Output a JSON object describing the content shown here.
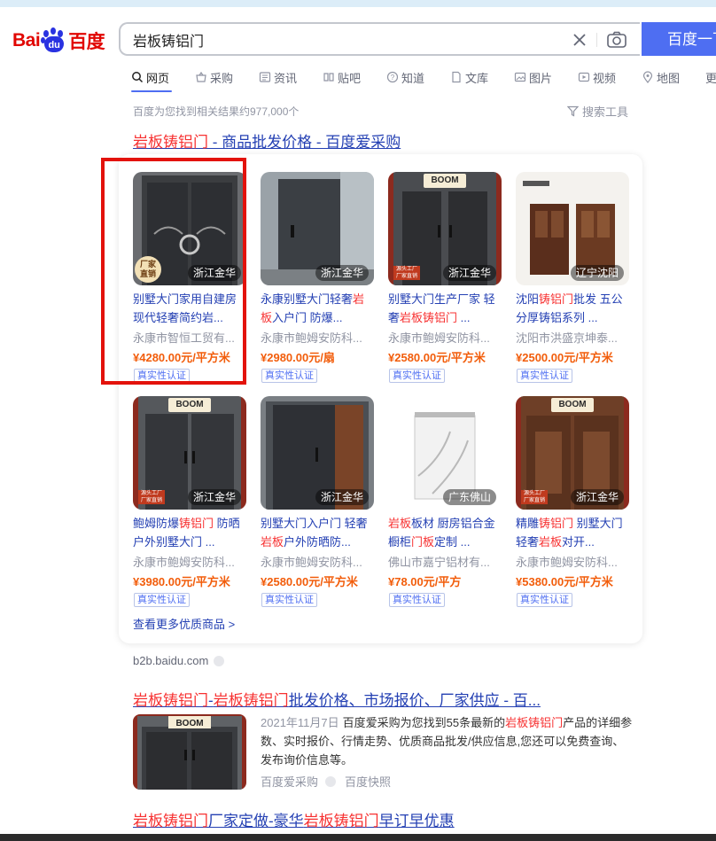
{
  "logo": {
    "text_left": "Bai",
    "text_paw": "du",
    "text_right": "百度"
  },
  "search": {
    "query": "岩板铸铝门",
    "button": "百度一下"
  },
  "tabs": [
    {
      "label": "网页",
      "icon": "search-icon"
    },
    {
      "label": "采购",
      "icon": "basket-icon"
    },
    {
      "label": "资讯",
      "icon": "news-icon"
    },
    {
      "label": "贴吧",
      "icon": "tieba-icon"
    },
    {
      "label": "知道",
      "icon": "question-icon"
    },
    {
      "label": "文库",
      "icon": "document-icon"
    },
    {
      "label": "图片",
      "icon": "image-icon"
    },
    {
      "label": "视频",
      "icon": "play-icon"
    },
    {
      "label": "地图",
      "icon": "map-pin-icon"
    },
    {
      "label": "更多",
      "icon": ""
    }
  ],
  "result_count": "百度为您找到相关结果约977,000个",
  "search_tools": "搜索工具",
  "result1": {
    "title_em": "岩板铸铝门",
    "title_rest": " - 商品批发价格 - 百度爱采购",
    "more_link": "查看更多优质商品 >",
    "source_url": "b2b.baidu.com",
    "products": [
      {
        "name_parts": [
          "别墅大门家用自建房现代轻奢简约岩..."
        ],
        "shop": "永康市智恒工贸有...",
        "price": "¥4280.00元/平方米",
        "location": "浙江金华",
        "badge": "厂家\n直销",
        "verify": "真实性认证",
        "style": "a"
      },
      {
        "name_parts": [
          "永康别墅大门轻奢",
          "岩板",
          "入户门 防爆..."
        ],
        "shop": "永康市鲍姆安防科...",
        "price": "¥2980.00元/扇",
        "location": "浙江金华",
        "badge": "",
        "verify": "真实性认证",
        "style": "b"
      },
      {
        "name_parts": [
          "别墅大门生产厂家 轻奢",
          "岩板铸铝门",
          " ..."
        ],
        "shop": "永康市鲍姆安防科...",
        "price": "¥2580.00元/平方米",
        "location": "浙江金华",
        "badge": "源头工厂 厂家直销",
        "boom": "BOOM",
        "verify": "真实性认证",
        "style": "c"
      },
      {
        "name_parts": [
          "沈阳",
          "铸铝门",
          "批发 五公分厚铸铝系列 ..."
        ],
        "shop": "沈阳市洪盛京坤泰...",
        "price": "¥2500.00元/平方米",
        "location": "辽宁沈阳",
        "badge": "",
        "verify": "真实性认证",
        "style": "d"
      },
      {
        "name_parts": [
          "鲍姆防爆",
          "铸铝门",
          " 防晒户外别墅大门 ..."
        ],
        "shop": "永康市鲍姆安防科...",
        "price": "¥3980.00元/平方米",
        "location": "浙江金华",
        "badge": "源头工厂 厂家直销",
        "boom": "BOOM",
        "verify": "真实性认证",
        "style": "e"
      },
      {
        "name_parts": [
          "别墅大门入户门 轻奢",
          "岩板",
          "户外防晒防..."
        ],
        "shop": "永康市鲍姆安防科...",
        "price": "¥2580.00元/平方米",
        "location": "浙江金华",
        "badge": "",
        "verify": "真实性认证",
        "style": "f"
      },
      {
        "name_parts": [
          "岩板",
          "板材 厨房铝合金橱柜",
          "门板",
          "定制 ..."
        ],
        "shop": "佛山市嘉宁铝材有...",
        "price": "¥78.00元/平方",
        "location": "广东佛山",
        "badge": "",
        "verify": "真实性认证",
        "style": "g"
      },
      {
        "name_parts": [
          "精雕",
          "铸铝门",
          " 别墅大门轻奢",
          "岩板",
          "对开..."
        ],
        "shop": "永康市鲍姆安防科...",
        "price": "¥5380.00元/平方米",
        "location": "浙江金华",
        "badge": "源头工厂 厂家直销",
        "boom": "BOOM",
        "verify": "真实性认证",
        "style": "h"
      }
    ]
  },
  "result2": {
    "title_parts": [
      "岩板铸铝门",
      "-",
      "岩板铸铝门",
      "批发价格、市场报价、厂家供应 - 百..."
    ],
    "date": "2021年11月7日",
    "abstract_parts": [
      "百度爱采购为您找到55条最新的",
      "岩板铸铝门",
      "产品的详细参数、实时报价、行情走势、优质商品批发/供应信息,您还可以免费查询、发布询价信息等。"
    ],
    "source": "百度爱采购",
    "snapshot": "百度快照",
    "boom": "BOOM"
  },
  "result3": {
    "title_parts": [
      "岩板铸铝门",
      "厂家定做-豪华",
      "岩板铸铝门",
      "早订早优惠"
    ]
  },
  "colors": {
    "accent": "#4e6ef2",
    "highlight": "#f73131",
    "link": "#2440b3",
    "price": "#f25d0b",
    "annotation": "#e3120b"
  }
}
